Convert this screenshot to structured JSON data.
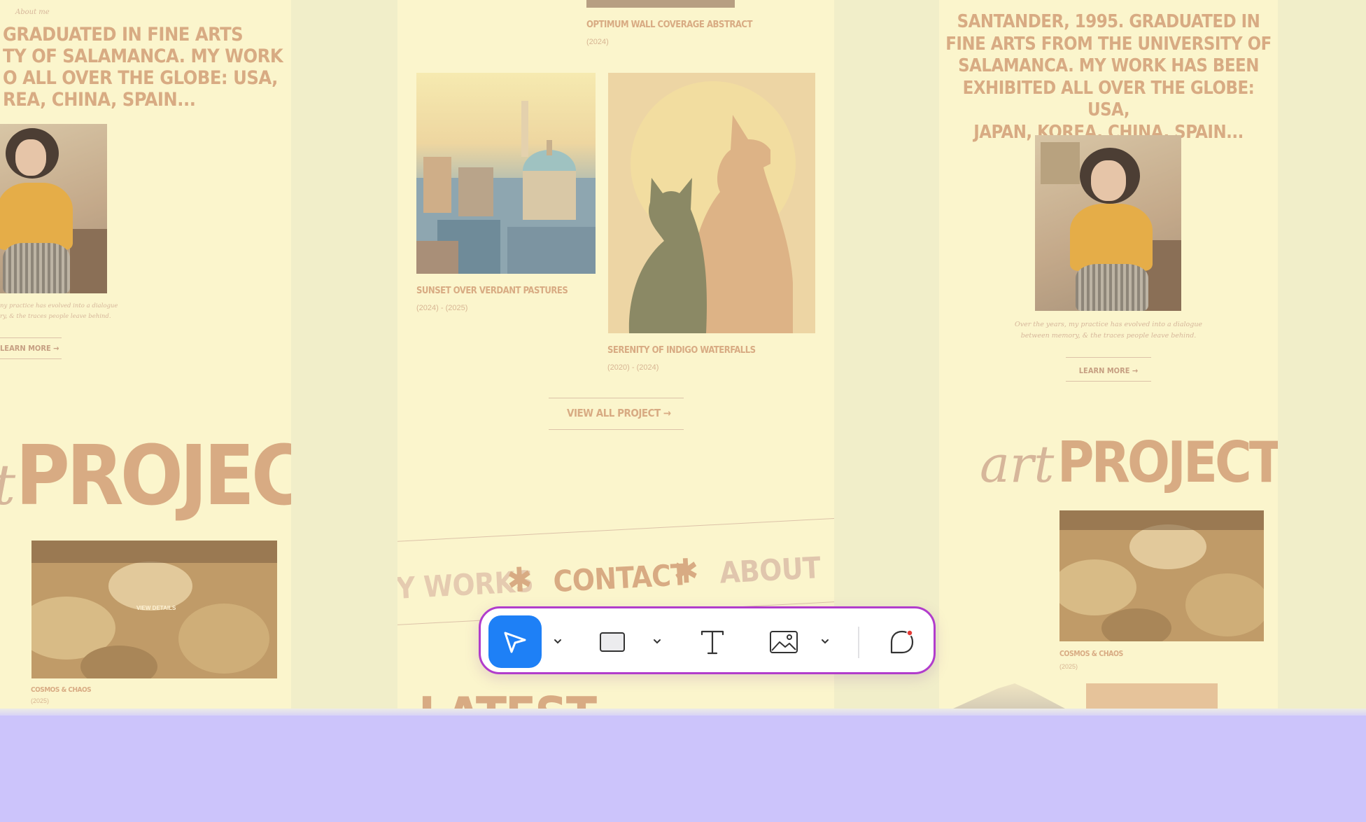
{
  "colors": {
    "canvas_bg": "#f1eec9",
    "board_bg": "#fbf5cc",
    "accent_tan": "#d8ab83",
    "toolbar_border": "#b13ccc",
    "select_active": "#1e80f6",
    "lower_panel": "#ccc4fb"
  },
  "boards": {
    "left": {
      "about_label": "About me",
      "bio_lines": [
        "GRADUATED IN FINE ARTS",
        "TY OF SALAMANCA. MY WORK",
        "O ALL OVER THE GLOBE: USA,",
        "REA, CHINA, SPAIN..."
      ],
      "caption_lines": [
        "ny practice has evolved into a dialogue",
        "ry, & the traces people leave behind."
      ],
      "learn_more": "LEARN MORE",
      "heading_italic": "t",
      "heading_bold": "PROJECT",
      "overlay_label": "VIEW DETAILS",
      "work_title": "COSMOS & CHAOS",
      "work_year": "(2025)"
    },
    "middle": {
      "top_title": "OPTIMUM WALL COVERAGE ABSTRACT",
      "top_year": "(2024)",
      "item1_title": "SUNSET OVER VERDANT PASTURES",
      "item1_year": "(2024) - (2025)",
      "item2_title": "SERENITY OF INDIGO WATERFALLS",
      "item2_year": "(2020) - (2024)",
      "view_all": "VIEW ALL PROJECT",
      "marquee": [
        "MY WORKS",
        "CONTACT",
        "ABOUT"
      ],
      "latest": "LATEST"
    },
    "right": {
      "bio_lines": [
        "SANTANDER, 1995. GRADUATED IN",
        "FINE ARTS FROM THE UNIVERSITY OF",
        "SALAMANCA. MY WORK HAS BEEN",
        "EXHIBITED ALL OVER THE GLOBE: USA,",
        "JAPAN, KOREA, CHINA, SPAIN..."
      ],
      "caption_lines": [
        "Over the years, my practice has evolved into a dialogue",
        "between memory, & the traces people leave behind."
      ],
      "learn_more": "LEARN MORE",
      "heading_italic": "art",
      "heading_bold": "PROJECTS",
      "work_title": "COSMOS & CHAOS",
      "work_year": "(2025)"
    }
  },
  "toolbar": {
    "tools": [
      {
        "icon": "cursor-arrow-icon",
        "label": "Select"
      },
      {
        "icon": "rectangle-icon",
        "label": "Shape"
      },
      {
        "icon": "text-t-icon",
        "label": "Text"
      },
      {
        "icon": "image-icon",
        "label": "Image"
      },
      {
        "icon": "comment-bubble-icon",
        "label": "Comment"
      }
    ],
    "active_tool": "Select"
  }
}
